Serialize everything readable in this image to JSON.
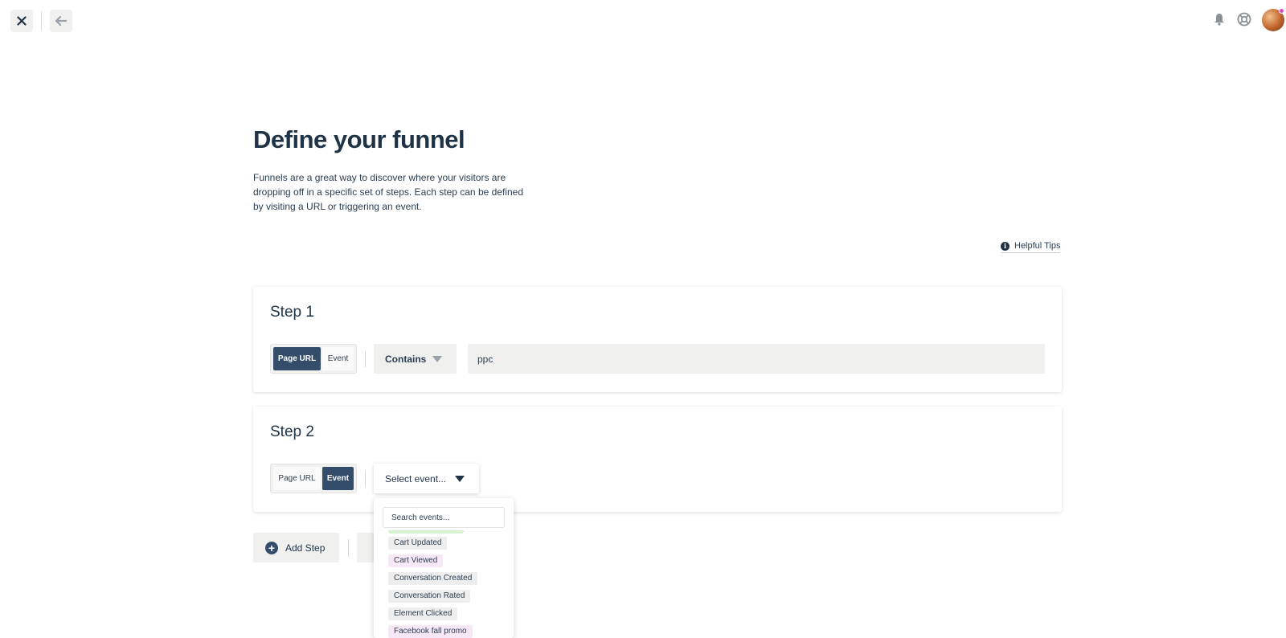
{
  "topbar": {
    "close_icon": "close-icon",
    "back_icon": "arrow-left-icon",
    "notifications_icon": "bell-icon",
    "help_icon": "lifebuoy-icon",
    "avatar": "user-avatar"
  },
  "header": {
    "title": "Define your funnel",
    "description": "Funnels are a great way to discover where your visitors are dropping off in a specific set of steps. Each step can be defined by visiting a URL or triggering an event.",
    "helpful_tips": "Helpful Tips",
    "info_glyph": "i"
  },
  "steps": [
    {
      "title": "Step 1",
      "toggle": {
        "page_url": "Page URL",
        "event": "Event",
        "selected": "Page URL"
      },
      "match_type": "Contains",
      "value": "ppc"
    },
    {
      "title": "Step 2",
      "toggle": {
        "page_url": "Page URL",
        "event": "Event",
        "selected": "Event"
      },
      "event_select": "Select event..."
    }
  ],
  "dropdown": {
    "search_placeholder": "Search events...",
    "events": [
      "Cart Updated",
      "Cart Viewed",
      "Conversation Created",
      "Conversation Rated",
      "Element Clicked",
      "Facebook fall promo"
    ]
  },
  "actions": {
    "add_step": "Add Step",
    "plus_glyph": "+"
  },
  "colors": {
    "primary_dark": "#344d6a",
    "text": "#1f3347",
    "field_bg": "#f0f0ef",
    "tag_purple": "#f6e8f7",
    "tag_green": "#d8f3d1",
    "avatar_badge": "#d94fd3"
  }
}
